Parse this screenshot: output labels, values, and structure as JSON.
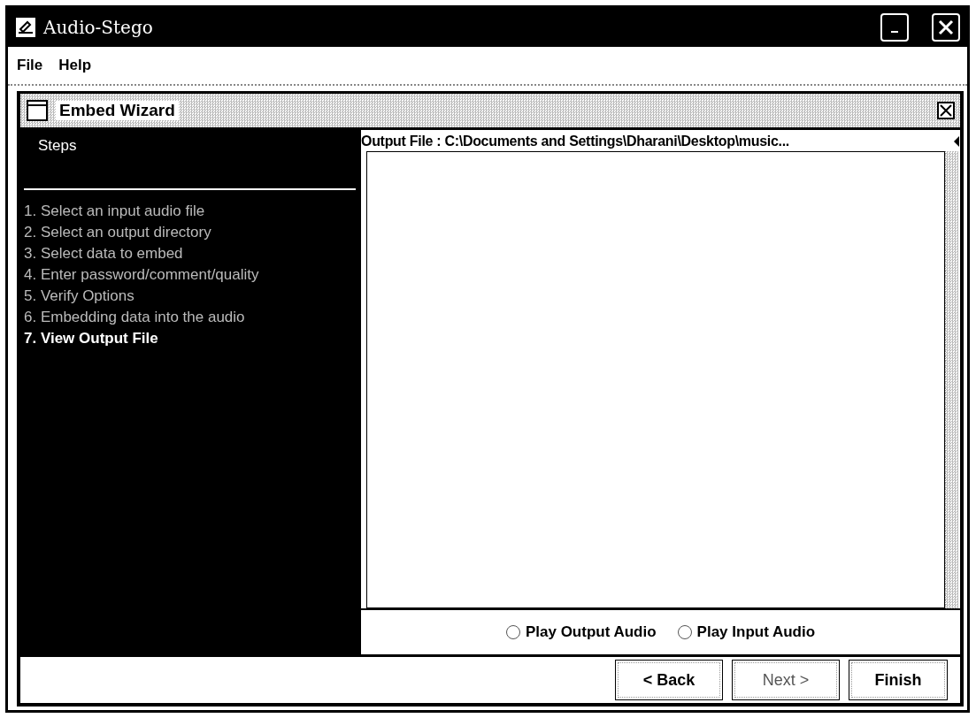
{
  "window": {
    "title": "Audio-Stego"
  },
  "menu": [
    "File",
    "Help"
  ],
  "wizard": {
    "title": "Embed Wizard",
    "steps_heading": "Steps",
    "steps": [
      {
        "label": "1. Select an input audio file",
        "current": false
      },
      {
        "label": "2. Select an output directory",
        "current": false
      },
      {
        "label": "3. Select data to embed",
        "current": false
      },
      {
        "label": "4. Enter password/comment/quality",
        "current": false
      },
      {
        "label": "5. Verify Options",
        "current": false
      },
      {
        "label": "6. Embedding data into the audio",
        "current": false
      },
      {
        "label": "7. View Output File",
        "current": true
      }
    ],
    "output_label": "Output File : C:\\Documents and Settings\\Dharani\\Desktop\\music...",
    "radios": [
      {
        "label": "Play Output Audio",
        "selected": false
      },
      {
        "label": "Play Input Audio",
        "selected": false
      }
    ],
    "buttons": [
      {
        "label": "< Back",
        "disabled": false
      },
      {
        "label": "Next >",
        "disabled": true
      },
      {
        "label": "Finish",
        "disabled": false
      }
    ]
  }
}
